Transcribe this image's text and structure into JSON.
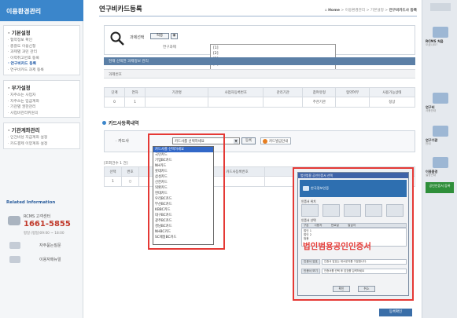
{
  "sidebar": {
    "title": "이용환경관리",
    "groups": [
      {
        "title": "· 기본설정",
        "items": [
          "· 협약정보 확인",
          "· 총괄도 이용신청",
          "· 과제별 과민 관리",
          "· 이력취고번호 등록",
          "· 연구비카드 등록",
          "· 연구비카드 과제 등록"
        ],
        "active_index": 4
      },
      {
        "title": "· 부가설정",
        "items": [
          "· 자주쓰는 사업자",
          "· 자주쓰는 입금계좌",
          "· 기관별 권한관리",
          "· 사업비관리위원의"
        ]
      },
      {
        "title": "· 기관계좌관리",
        "items": [
          "· 인건비성 지급계좌 설정",
          "· 카드결제 이양계좌 설정"
        ]
      }
    ],
    "related": {
      "title": "Related Information",
      "call_label": "RCMS 고객센터",
      "call_number": "1661-5855",
      "call_hours": "평일 (평일)09:00 ~ 18:00",
      "links": [
        "자주묻는질문",
        "이용자매뉴얼"
      ]
    }
  },
  "main": {
    "title": "연구비카드등록",
    "breadcrumb": [
      "Home",
      "이용환경관리",
      "기본설정",
      "연구비카드사 등록"
    ],
    "search": {
      "label": "과제선택",
      "button": "적용",
      "reset": "◉",
      "research_label": "연구과제",
      "list": [
        "[1]",
        "[2]",
        "[3]",
        "[4]"
      ]
    },
    "info_header": "현재 선택한 과제정보 관리",
    "task_no_label": "과제번호",
    "info_table": {
      "headers": [
        "단계",
        "연차",
        "기관명",
        "사업자등록번호",
        "관리기관",
        "참여유형",
        "협약여부",
        "사용가능상태"
      ],
      "row": [
        "0",
        "1",
        "",
        "",
        "",
        "주관기관",
        "",
        "정상"
      ]
    },
    "card_section": {
      "title": "카드사등록내역",
      "card_label": "· 카드사",
      "select_value": "카드사를 선택하세요",
      "register_btn": "등록",
      "notice": "카드발급안내",
      "options": [
        "카드사를 선택하세요",
        "국민카드",
        "기업BC카드",
        "NH카드",
        "롯데카드",
        "삼성카드",
        "신한카드",
        "외환카드",
        "현대카드",
        "우리BC카드",
        "부산BC카드",
        "KBBC카드",
        "대구BC카드",
        "광주BC카드",
        "경남BC카드",
        "NHBC카드",
        "SC제일BC카드"
      ],
      "selected_index": 0
    },
    "count_label": "[조회건수 1 건]",
    "lower_table": {
      "headers": [
        "선택",
        "번호",
        "카드사명",
        "카드사등록번호",
        "카드사등록상태",
        "등록일"
      ],
      "row": [
        "1",
        "○",
        "",
        "",
        "",
        ""
      ]
    },
    "cert_dialog": {
      "title": "법인범용 공인인증서 선택",
      "banner": "한국정보인증",
      "section_location": "인증서 위치",
      "section_select": "인증서 선택",
      "list_headers": [
        "구분",
        "사용자",
        "만료일",
        "발급자"
      ],
      "list_rows": [
        "법인 1",
        "법인 2",
        "범용"
      ],
      "overlay": "법인범용공인인증서",
      "pw_label": "인증서 암호",
      "pw_hint": "인증서 암호는 대소문자를 구분합니다.",
      "keypad_label": "인증서 보기",
      "keypad_hint": "인증서를 선택 후 암호를 입력하세요",
      "buttons": [
        "확인",
        "취소"
      ]
    },
    "bottom_button": "등록확인"
  },
  "quick_panel": {
    "items": [
      {
        "title": "RCMS 처음",
        "sub": "오셨나요?"
      },
      {
        "title": "연구비",
        "sub": "사용안내"
      },
      {
        "title": "연구기관",
        "sub": "안내"
      },
      {
        "title": "이용환경",
        "sub": "설정안내"
      }
    ],
    "badge": "공인인증서 등록"
  },
  "colors": {
    "accent_blue": "#3b86cb",
    "highlight_red": "#e53935",
    "header_steel": "#5b7fa6"
  }
}
